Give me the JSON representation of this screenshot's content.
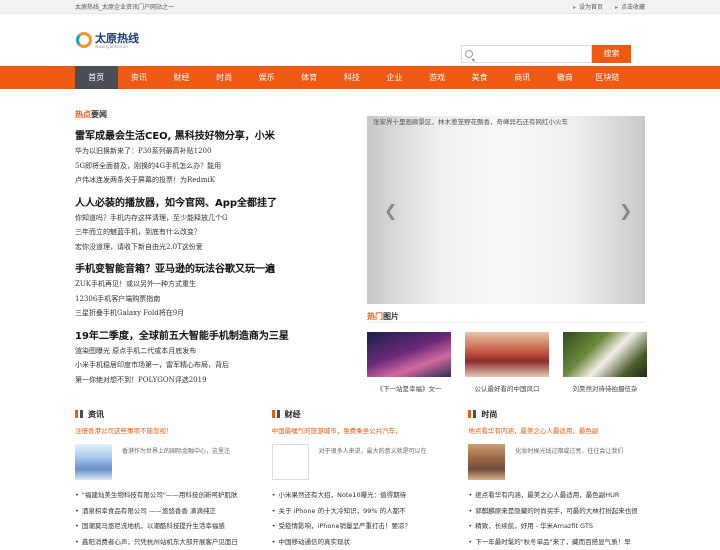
{
  "topbar": {
    "left_text": "太原热线_太原企业资讯门户网站之一",
    "set_home": "设为首页",
    "bookmark": "点击收藏"
  },
  "logo": {
    "name": "太原热线",
    "url": "www.tyonline.cn"
  },
  "search": {
    "placeholder": "",
    "button": "搜索"
  },
  "nav": [
    "首页",
    "资讯",
    "财经",
    "时尚",
    "娱乐",
    "体育",
    "科技",
    "企业",
    "游戏",
    "美食",
    "商讯",
    "徽商",
    "区块链"
  ],
  "hot": {
    "title_hl": "热点",
    "title_rest": "要闻",
    "blocks": [
      {
        "headline": "雷军成最会生活CEO, 黑科技好物分享，小米",
        "items": [
          "华为以旧换新来了：P30系列最高补贴1200",
          "5G即将全面普及，刚换的4G手机怎么办？能用",
          "卢伟冰连发两条关于屏幕的投票！为RedmiK"
        ]
      },
      {
        "headline": "人人必装的播放器，如今官网、App全都挂了",
        "items": [
          "你知道吗？手机内存这样清理，至少能释放几个G",
          "三年而立的魅蓝手机，到底有什么改变？",
          "宏你没道理，请收下新自由光2.0T这份爱"
        ]
      },
      {
        "headline": "手机变智能音箱？亚马逊的玩法谷歌又玩一遍",
        "items": [
          "ZUK手机再见！或以另外一种方式重生",
          "12306手机客户端购票指南",
          "三星折叠手机Galaxy Fold将在9月"
        ]
      },
      {
        "headline": "19年二季度，全球前五大智能手机制造商为三星",
        "items": [
          "渲染图曝光 原点手机二代或本月底发布",
          "小米手机稳居印度市场第一，雷军精心布局，背后",
          "第一你绝对想不到！POLYGON评选2019"
        ]
      }
    ]
  },
  "slider": {
    "caption": "张家界十里画廊景区，林木葱茏野花飘香，奇峰异石还有网红小火车"
  },
  "pics": {
    "title_hl": "热门",
    "title_rest": "图片",
    "items": [
      "《下一站是幸福》文一",
      "公认最好看的中国风口",
      "刘昊然对待待拍摄伍杂"
    ]
  },
  "cols": [
    {
      "title": "资讯",
      "lead": "注册香港公司这些事项不能忽视！",
      "feature_text": "香港作为世界上的国际金融中心，这里注",
      "items": [
        "\"福建灿美生物科技有限公司\"——用科技创新呵护肌肤",
        "酒泉枳幸食品有限公司 ——悠悠香香 滴滴纯正",
        "国潮莫马悠尼洗地机，以潮酷科技提升生活幸福感",
        "鑫阳消费者心声，只凭杭州站机东大部开展客户见面日"
      ]
    },
    {
      "title": "财经",
      "lead": "中国最嘱气的旅游城市，免费乘坐公共汽车，",
      "feature_text": "对于很多人来说，最大的意义就是可以在",
      "items": [
        "小米果然还有大招，Note10曝光：值得期待",
        "关于 iPhone 的十大冷知识，99% 的人都不",
        "受疫情影响，iPhone销量呈严重打击！要凉？",
        "中国移动通信的真实现状"
      ]
    },
    {
      "title": "时尚",
      "lead": "地点看华有内涵，最美之心人最适用，最色副",
      "feature_text": "化妆时候光线过暗或过亮，往往会让我们",
      "items": [
        "绝点看华有内涵，最美之心人最适用，最色副HUR",
        "郭麒麟原来是隐藏的时尚买手，可最的大林打扮起来也很",
        "精致，长续航，好用 - 华米Amazfit GTS",
        "下一年最时髦的\"秋冬单品\"来了，藏而百搭显气质！早"
      ]
    }
  ]
}
